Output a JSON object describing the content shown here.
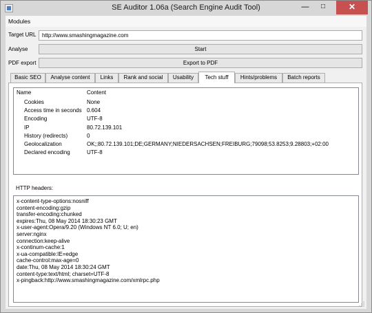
{
  "window": {
    "title": "SE Auditor 1.06a (Search Engine Audit Tool)"
  },
  "menubar": {
    "items": [
      "Modules"
    ]
  },
  "form": {
    "target_url_label": "Target URL",
    "target_url_value": "http://www.smashingmagazine.com",
    "analyse_label": "Analyse",
    "start_button": "Start",
    "pdf_label": "PDF export",
    "export_button": "Export to PDF"
  },
  "tabs": [
    {
      "label": "Basic SEO",
      "active": false
    },
    {
      "label": "Analyse content",
      "active": false
    },
    {
      "label": "Links",
      "active": false
    },
    {
      "label": "Rank and social",
      "active": false
    },
    {
      "label": "Usability",
      "active": false
    },
    {
      "label": "Tech stuff",
      "active": true
    },
    {
      "label": "Hints/problems",
      "active": false
    },
    {
      "label": "Batch reports",
      "active": false
    }
  ],
  "table": {
    "columns": [
      "Name",
      "Content"
    ],
    "rows": [
      {
        "name": "Cookies",
        "content": "None"
      },
      {
        "name": "Access time in seconds",
        "content": "0.604"
      },
      {
        "name": "Encoding",
        "content": "UTF-8"
      },
      {
        "name": "IP",
        "content": "80.72.139.101"
      },
      {
        "name": "History (redirects)",
        "content": "0"
      },
      {
        "name": "Geolocalization",
        "content": "OK;;80.72.139.101;DE;GERMANY;NIEDERSACHSEN;FREIBURG;79098;53.8253;9.28803;+02:00"
      },
      {
        "name": "Declared encoding",
        "content": "UTF-8"
      }
    ]
  },
  "http_headers": {
    "label": "HTTP headers:",
    "lines": [
      "x-content-type-options:nosniff",
      "content-encoding:gzip",
      "transfer-encoding:chunked",
      "expires:Thu, 08 May 2014 18:30:23 GMT",
      "x-user-agent:Opera/9.20 (Windows NT 6.0; U; en)",
      "server:nginx",
      "connection:keep-alive",
      "x-continum-cache:1",
      "x-ua-compatible:IE=edge",
      "cache-control:max-age=0",
      "date:Thu, 08 May 2014 18:30:24 GMT",
      "content-type:text/html; charset=UTF-8",
      "x-pingback:http://www.smashingmagazine.com/xmlrpc.php"
    ]
  }
}
